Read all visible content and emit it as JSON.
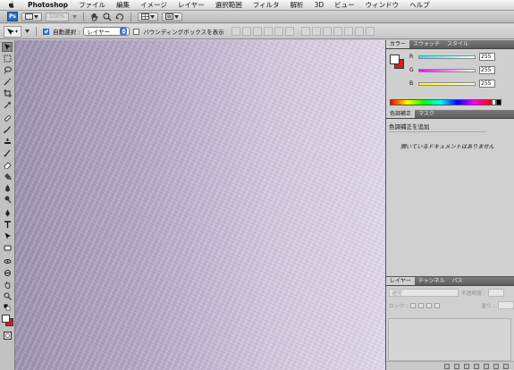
{
  "menubar": {
    "app_name": "Photoshop",
    "items": [
      "ファイル",
      "編集",
      "イメージ",
      "レイヤー",
      "選択範囲",
      "フィルタ",
      "解析",
      "3D",
      "ビュー",
      "ウィンドウ",
      "ヘルプ"
    ]
  },
  "appbar": {
    "logo": "Ps",
    "zoom_value": "100%"
  },
  "options": {
    "auto_select_label": "自動選択 :",
    "auto_select_checked": true,
    "auto_select_value": "レイヤー",
    "show_bbox_label": "バウンディングボックスを表示",
    "show_bbox_checked": false
  },
  "color_panel": {
    "tabs": [
      "カラー",
      "スウォッチ",
      "スタイル"
    ],
    "foreground": "#ffffff",
    "background": "#c8222d",
    "channels": [
      {
        "label": "R",
        "value": "255"
      },
      {
        "label": "G",
        "value": "255"
      },
      {
        "label": "B",
        "value": "255"
      }
    ]
  },
  "adjustments_panel": {
    "tabs": [
      "色調補正",
      "マスク"
    ],
    "title": "色調補正を追加",
    "message": "開いているドキュメントはありません"
  },
  "layers_panel": {
    "tabs": [
      "レイヤー",
      "チャンネル",
      "パス"
    ],
    "blend_mode": "通常",
    "opacity_label": "不透明度 :",
    "lock_label": "ロック :",
    "fill_label": "塗り :"
  }
}
